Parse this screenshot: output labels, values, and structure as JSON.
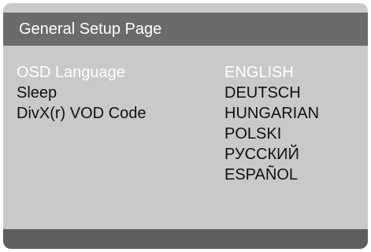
{
  "page": {
    "title": "General Setup Page"
  },
  "settings": [
    {
      "label": "OSD Language",
      "selected": true
    },
    {
      "label": "Sleep",
      "selected": false
    },
    {
      "label": "DivX(r) VOD Code",
      "selected": false
    }
  ],
  "language_options": [
    {
      "label": "ENGLISH",
      "selected": true
    },
    {
      "label": "DEUTSCH",
      "selected": false
    },
    {
      "label": "HUNGARIAN",
      "selected": false
    },
    {
      "label": "POLSKI",
      "selected": false
    },
    {
      "label": "РУССКИЙ",
      "selected": false
    },
    {
      "label": "ESPAÑOL",
      "selected": false
    }
  ],
  "colors": {
    "panel_background": "#c9c9c9",
    "title_bar": "#6b6b6b",
    "bottom_bar": "#5e5e5e",
    "selected_text": "#ffffff",
    "normal_text": "#111111"
  }
}
